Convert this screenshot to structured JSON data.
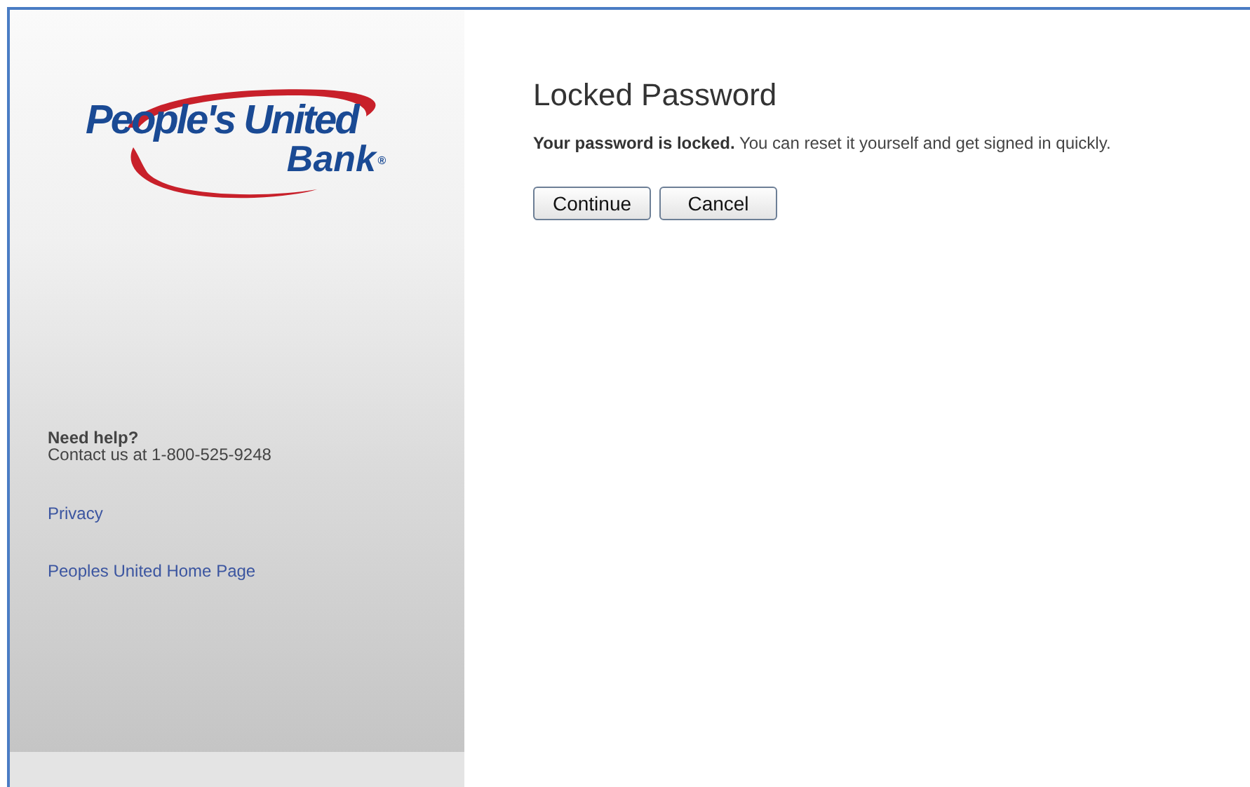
{
  "logo": {
    "line_1": "People's United",
    "line_2": "Bank",
    "mark": "®"
  },
  "sidebar": {
    "help_title": "Need help?",
    "help_text": "Contact us at 1-800-525-9248",
    "links": [
      {
        "label": "Privacy"
      },
      {
        "label": "Peoples United Home Page"
      }
    ]
  },
  "main": {
    "title": "Locked Password",
    "message": "**Your password is locked.** You can reset it yourself and get signed in quickly.",
    "buttons": [
      {
        "label": "Continue"
      },
      {
        "label": "Cancel"
      }
    ]
  }
}
